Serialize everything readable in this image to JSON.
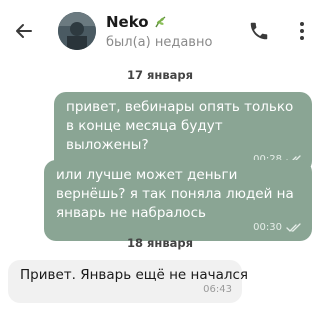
{
  "header": {
    "contact_name": "Neko",
    "contact_status": "был(а) недавно",
    "name_emoji": "herb-emoji"
  },
  "dates": [
    "17 января",
    "18 января"
  ],
  "messages": [
    {
      "direction": "outgoing",
      "text": "привет, вебинары опять только в конце месяца будут выложены?",
      "time": "00:28",
      "status": "read"
    },
    {
      "direction": "outgoing",
      "text": "или лучше может деньги вернёшь? я так поняла людей на январь не набралось",
      "time": "00:30",
      "status": "read"
    },
    {
      "direction": "incoming",
      "text": "Привет. Январь ещё не начался",
      "time": "06:43"
    }
  ],
  "colors": {
    "outgoing_bubble": "#8aa594",
    "incoming_bubble": "#f1f1f1",
    "header_bg": "#ffffff"
  }
}
